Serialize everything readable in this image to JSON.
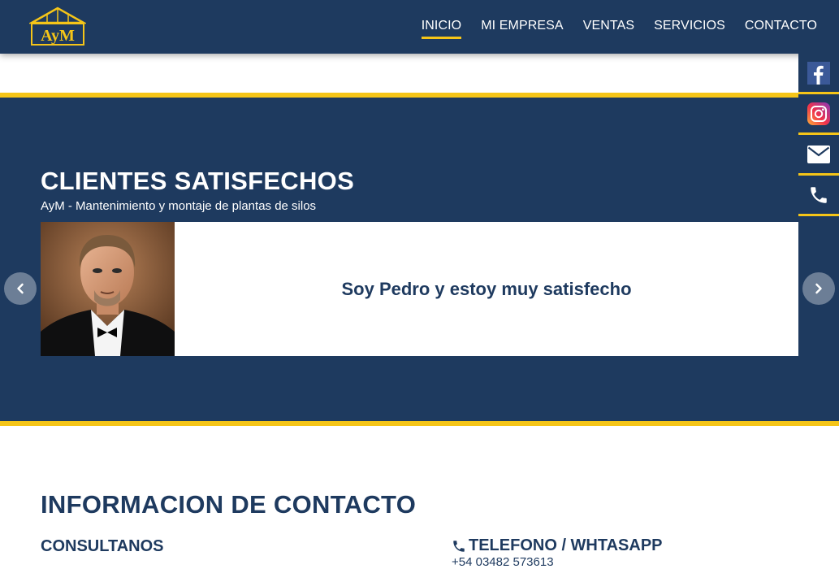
{
  "brand": {
    "logo_text": "AyM"
  },
  "nav": {
    "items": [
      {
        "label": "INICIO",
        "active": true
      },
      {
        "label": "MI EMPRESA",
        "active": false
      },
      {
        "label": "VENTAS",
        "active": false
      },
      {
        "label": "SERVICIOS",
        "active": false
      },
      {
        "label": "CONTACTO",
        "active": false
      }
    ]
  },
  "social": [
    "facebook-icon",
    "instagram-icon",
    "email-icon",
    "phone-icon"
  ],
  "testimonials": {
    "title": "CLIENTES SATISFECHOS",
    "subtitle": "AyM - Mantenimiento y montaje de plantas de silos",
    "quote": "Soy Pedro y estoy muy satisfecho"
  },
  "contact": {
    "heading": "INFORMACION DE CONTACTO",
    "consult_label": "CONSULTANOS",
    "phone_label": "TELEFONO / WHTASAPP",
    "phone_number": "+54 03482 573613"
  },
  "colors": {
    "primary": "#1e3a5f",
    "accent": "#f5c518",
    "white": "#ffffff"
  }
}
